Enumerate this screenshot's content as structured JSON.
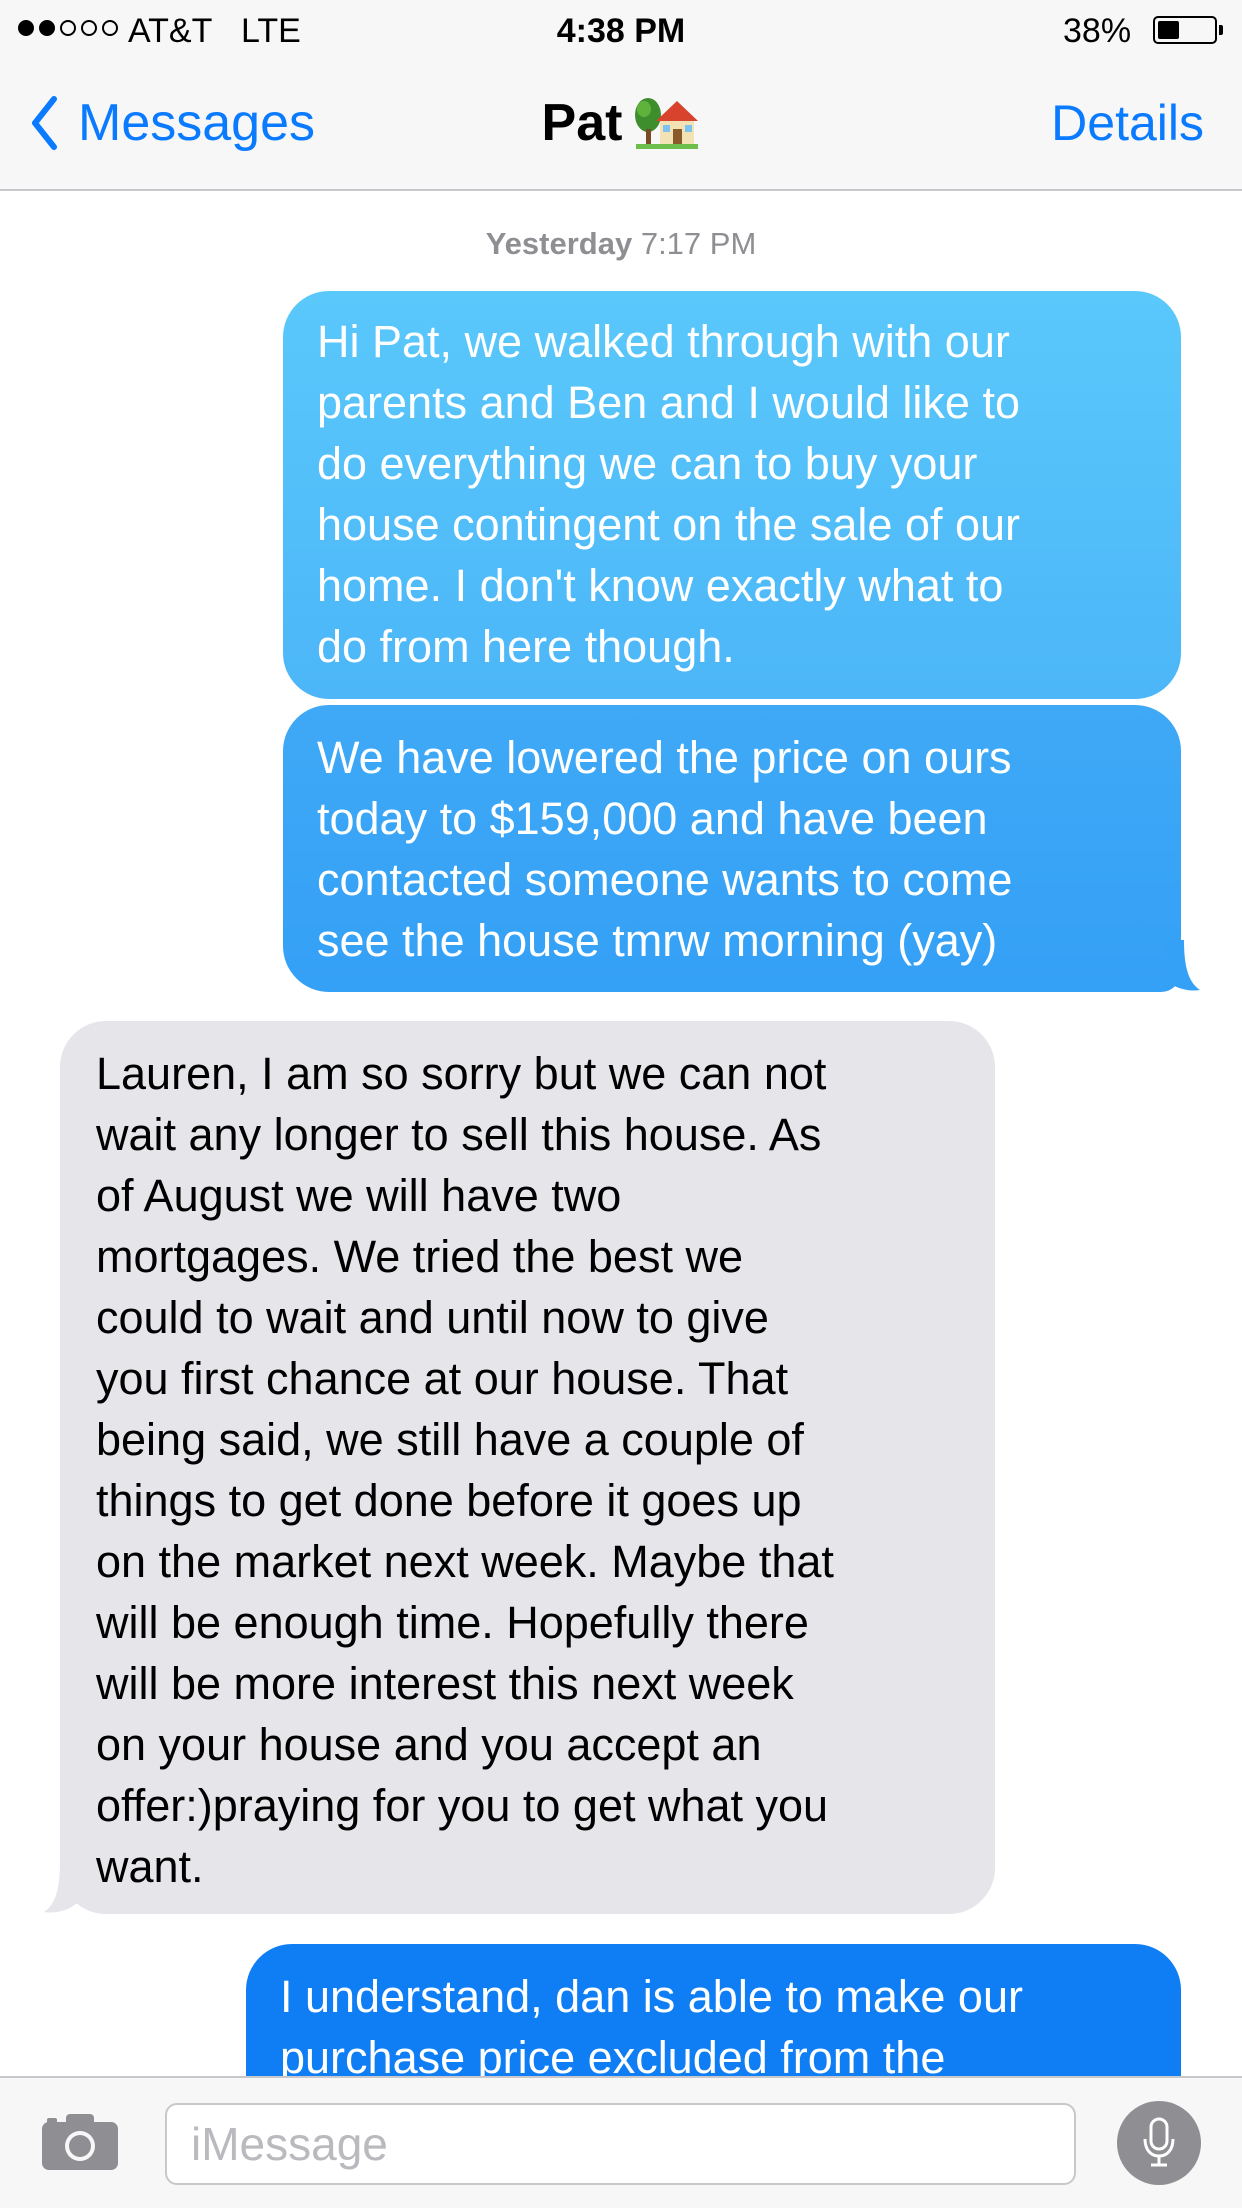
{
  "status_bar": {
    "signal_bars_filled": 2,
    "signal_bars_total": 5,
    "carrier": "AT&T",
    "network": "LTE",
    "time": "4:38 PM",
    "battery_percent_text": "38%",
    "battery_level": 0.38
  },
  "nav": {
    "back_label": "Messages",
    "back_icon": "chevron-left-icon",
    "contact_name": "Pat",
    "contact_emoji_icon": "house-with-garden-icon",
    "details_label": "Details"
  },
  "conversation": {
    "timestamp_day": "Yesterday",
    "timestamp_time": "7:17 PM",
    "messages": [
      {
        "direction": "outgoing",
        "text": "Hi Pat, we walked through with our\nparents and Ben and I would like to\ndo everything we can to buy your\nhouse contingent on the sale of our\nhome. I don't know exactly what to\ndo from here though."
      },
      {
        "direction": "outgoing",
        "text": "We have lowered the price on ours\ntoday to $159,000 and have been\ncontacted someone wants to come\nsee the house tmrw morning (yay)"
      },
      {
        "direction": "incoming",
        "text": "Lauren, I am so sorry but we can not\nwait any longer to sell this house. As\nof August we will have two\nmortgages. We tried the best we\ncould to wait and until now to give\nyou first chance at our house. That\nbeing said, we still have a couple of\nthings to get done before it goes up\non the market next week. Maybe that\nwill be enough time. Hopefully there\nwill be more interest this next week\non your house and you accept an\noffer:)praying for you to get what you\nwant."
      },
      {
        "direction": "outgoing",
        "text": "I understand, dan is able to make our\npurchase price excluded from the"
      }
    ]
  },
  "input_bar": {
    "camera_icon": "camera-icon",
    "placeholder": "iMessage",
    "value": "",
    "mic_icon": "microphone-icon"
  },
  "colors": {
    "ios_blue": "#0a7aff",
    "bubble_outgoing_light": "#5ac8fb",
    "bubble_outgoing_dark": "#0f7ef4",
    "bubble_incoming": "#e5e5ea",
    "bar_background": "#f7f7f8",
    "secondary_text": "#8e8e93"
  }
}
